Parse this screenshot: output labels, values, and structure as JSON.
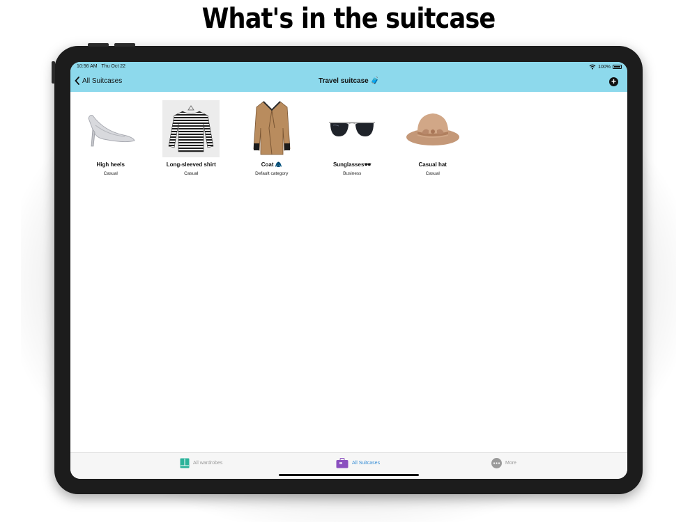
{
  "headline": "What's in the suitcase",
  "status_bar": {
    "time": "10:56 AM",
    "date": "Thu Oct 22",
    "battery": "100%"
  },
  "nav": {
    "back_label": "All Suitcases",
    "title": "Travel suitcase 🧳",
    "add_icon": "plus-circle-icon"
  },
  "items": [
    {
      "name": "High heels",
      "category": "Casual",
      "icon": "high-heel-image"
    },
    {
      "name": "Long-sleeved shirt",
      "category": "Casual",
      "icon": "striped-shirt-image"
    },
    {
      "name": "Coat 🧥",
      "category": "Default category",
      "icon": "coat-image"
    },
    {
      "name": "Sunglasses🕶",
      "category": "Business",
      "icon": "sunglasses-image"
    },
    {
      "name": "Casual hat",
      "category": "Casual",
      "icon": "hat-image"
    }
  ],
  "tabs": [
    {
      "label": "All wardrobes",
      "icon": "wardrobe-icon",
      "active": false
    },
    {
      "label": "All Suitcases",
      "icon": "suitcase-icon",
      "active": true
    },
    {
      "label": "More",
      "icon": "more-icon",
      "active": false
    }
  ],
  "colors": {
    "nav_bg": "#8dd9ec",
    "active_tab": "#3a8fd6",
    "wardrobe_icon": "#2bb39a",
    "suitcase_icon": "#8a4fbf"
  }
}
